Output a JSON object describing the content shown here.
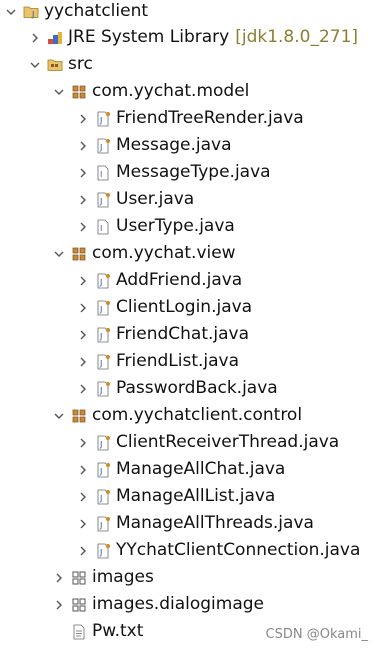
{
  "project": {
    "name": "yychatclient"
  },
  "jre": {
    "name": "JRE System Library",
    "decoration": "[jdk1.8.0_271]"
  },
  "src": {
    "name": "src"
  },
  "packages": [
    {
      "name": "com.yychat.model",
      "files": [
        {
          "name": "FriendTreeRender.java",
          "icon": "java-file-icon"
        },
        {
          "name": "Message.java",
          "icon": "java-file-icon"
        },
        {
          "name": "MessageType.java",
          "icon": "java-interface-file-icon"
        },
        {
          "name": "User.java",
          "icon": "java-file-icon"
        },
        {
          "name": "UserType.java",
          "icon": "java-interface-file-icon"
        }
      ]
    },
    {
      "name": "com.yychat.view",
      "files": [
        {
          "name": "AddFriend.java",
          "icon": "java-file-icon"
        },
        {
          "name": "ClientLogin.java",
          "icon": "java-file-icon"
        },
        {
          "name": "FriendChat.java",
          "icon": "java-file-icon"
        },
        {
          "name": "FriendList.java",
          "icon": "java-file-icon"
        },
        {
          "name": "PasswordBack.java",
          "icon": "java-file-icon"
        }
      ]
    },
    {
      "name": "com.yychatclient.control",
      "files": [
        {
          "name": "ClientReceiverThread.java",
          "icon": "java-file-icon"
        },
        {
          "name": "ManageAllChat.java",
          "icon": "java-file-icon"
        },
        {
          "name": "ManageAllList.java",
          "icon": "java-file-icon"
        },
        {
          "name": "ManageAllThreads.java",
          "icon": "java-file-icon"
        },
        {
          "name": "YYchatClientConnection.java",
          "icon": "java-file-icon"
        }
      ]
    }
  ],
  "folders": [
    {
      "name": "images"
    },
    {
      "name": "images.dialogimage"
    }
  ],
  "file": {
    "name": "Pw.txt"
  },
  "watermark": "CSDN @Okami_"
}
